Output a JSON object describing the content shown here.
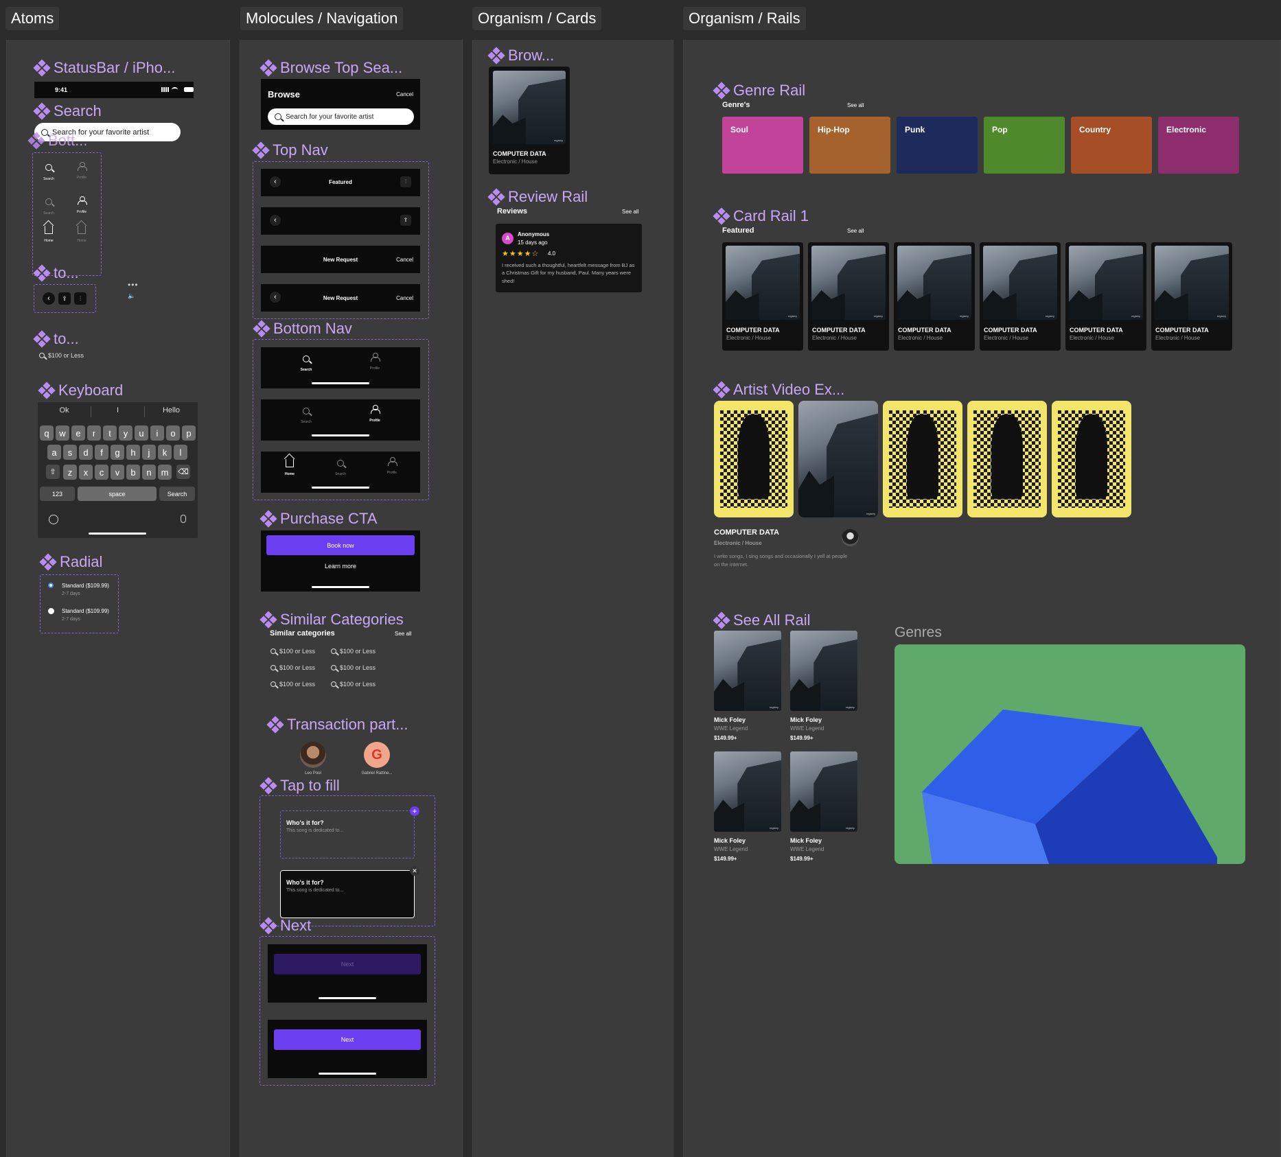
{
  "sections": {
    "atoms": "Atoms",
    "molecules": "Molocules / Navigation",
    "cards": "Organism / Cards",
    "rails": "Organism / Rails"
  },
  "atoms": {
    "statusbar_label": "StatusBar / iPho...",
    "time": "9:41",
    "search_label": "Search",
    "search_placeholder": "Search for your favorite artist",
    "bott_label": "Bott...",
    "nav_search": "Search",
    "nav_profile": "Profile",
    "nav_home": "Home",
    "to_label_1": "to...",
    "to_label_2": "to...",
    "chip_text": "$100 or Less",
    "keyboard_label": "Keyboard",
    "suggestions": [
      "Ok",
      "I",
      "Hello"
    ],
    "row1": [
      "q",
      "w",
      "e",
      "r",
      "t",
      "y",
      "u",
      "i",
      "o",
      "p"
    ],
    "row2": [
      "a",
      "s",
      "d",
      "f",
      "g",
      "h",
      "j",
      "k",
      "l"
    ],
    "row3": [
      "z",
      "x",
      "c",
      "v",
      "b",
      "n",
      "m"
    ],
    "key_123": "123",
    "key_space": "space",
    "key_search": "Search",
    "radial_label": "Radial",
    "radial_options": [
      {
        "title": "Standard ($109.99)",
        "sub": "2-7 days",
        "selected": true
      },
      {
        "title": "Standard ($109.99)",
        "sub": "2-7 days",
        "selected": false
      }
    ]
  },
  "molecules": {
    "browse_label": "Browse Top Sea...",
    "browse_title": "Browse",
    "browse_cancel": "Cancel",
    "browse_search": "Search for your favorite artist",
    "topnav_label": "Top Nav",
    "topnav_featured": "Featured",
    "topnav_new_request": "New Request",
    "topnav_cancel": "Cancel",
    "bottomnav_label": "Bottom Nav",
    "nav_search": "Search",
    "nav_profile": "Profile",
    "nav_home": "Home",
    "purchase_label": "Purchase CTA",
    "book_now": "Book now",
    "learn_more": "Learn more",
    "similar_label": "Similar Categories",
    "similar_title": "Similar categories",
    "similar_see_all": "See all",
    "similar_items": [
      "$100 or Less",
      "$100 or Less",
      "$100 or Less",
      "$100 or Less",
      "$100 or Less",
      "$100 or Less"
    ],
    "transaction_label": "Transaction part...",
    "participants": [
      {
        "name": "Leo Pool",
        "initial": ""
      },
      {
        "name": "Gabriel Rattine...",
        "initial": "G"
      }
    ],
    "tap_label": "Tap to fill",
    "tap_question": "Who's it for?",
    "tap_placeholder": "This song is dedicated to...",
    "next_label": "Next",
    "next_button": "Next"
  },
  "cards": {
    "browse_label": "Brow...",
    "card_title": "COMPUTER DATA",
    "card_sub": "Electronic / House",
    "review_label": "Review Rail",
    "reviews_title": "Reviews",
    "see_all": "See all",
    "reviewer_initial": "A",
    "reviewer": "Anonymous",
    "review_date": "15 days ago",
    "rating": "4.0",
    "review_text": "I received such a thoughtful, heartfelt message from BJ as a Christmas Gift for my husband, Paul. Many years were shed!"
  },
  "rails": {
    "genre_label": "Genre Rail",
    "genre_title": "Genre's",
    "see_all": "See all",
    "genres": [
      {
        "name": "Soul",
        "color": "#c2449a"
      },
      {
        "name": "Hip-Hop",
        "color": "#a5622d"
      },
      {
        "name": "Punk",
        "color": "#1f2a5c"
      },
      {
        "name": "Pop",
        "color": "#4e8a2c"
      },
      {
        "name": "Country",
        "color": "#a64e26"
      },
      {
        "name": "Electronic",
        "color": "#8e2d6e"
      }
    ],
    "card_rail_label": "Card Rail 1",
    "featured_title": "Featured",
    "card_title": "COMPUTER DATA",
    "card_sub": "Electronic / House",
    "artist_label": "Artist Video Ex...",
    "artist_title": "COMPUTER DATA",
    "artist_sub": "Electronic / House",
    "artist_bio": "I write songs, I sing songs and occasionally I yell at people on the internet.",
    "seeall_label": "See All Rail",
    "grid_items": [
      {
        "name": "Mick Foley",
        "sub": "WWE Legend",
        "price": "$149.99+"
      },
      {
        "name": "Mick Foley",
        "sub": "WWE Legend",
        "price": "$149.99+"
      },
      {
        "name": "Mick Foley",
        "sub": "WWE Legend",
        "price": "$149.99+"
      },
      {
        "name": "Mick Foley",
        "sub": "WWE Legend",
        "price": "$149.99+"
      }
    ],
    "genres_frame_label": "Genres",
    "genres_frame_bg": "#5fa96a",
    "cube_color": "#2f5ee8"
  }
}
